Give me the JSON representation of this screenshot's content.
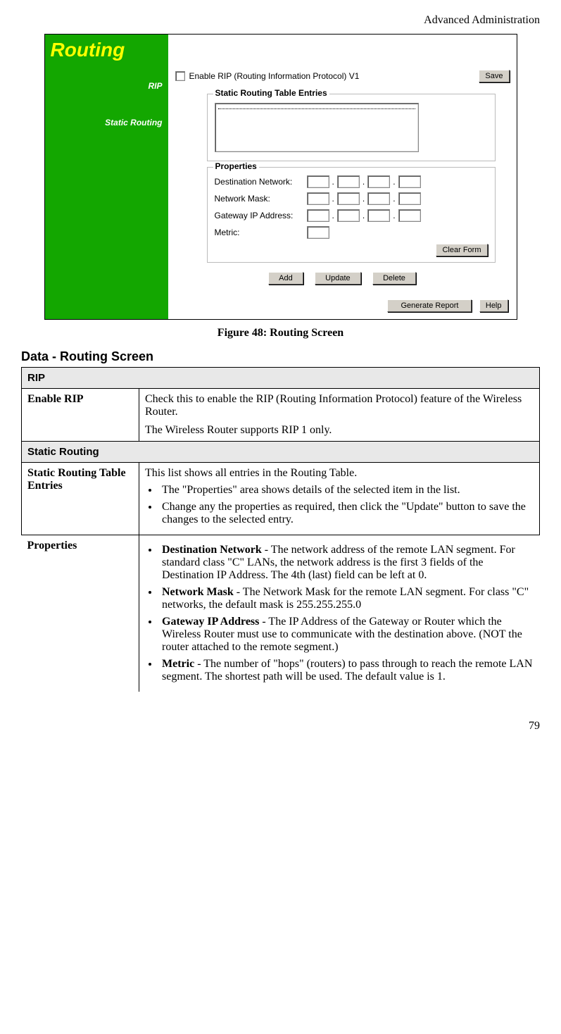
{
  "header": {
    "section": "Advanced Administration"
  },
  "routerUi": {
    "title": "Routing",
    "sidebar": {
      "rip": "RIP",
      "static": "Static Routing"
    },
    "rip": {
      "checkboxLabel": "Enable RIP (Routing Information Protocol) V1",
      "saveBtn": "Save"
    },
    "staticBox": {
      "legend": "Static Routing Table Entries"
    },
    "propsBox": {
      "legend": "Properties",
      "destLabel": "Destination Network:",
      "maskLabel": "Network Mask:",
      "gwLabel": "Gateway IP Address:",
      "metricLabel": "Metric:",
      "clearBtn": "Clear Form"
    },
    "buttons": {
      "add": "Add",
      "update": "Update",
      "delete": "Delete"
    },
    "footer": {
      "report": "Generate Report",
      "help": "Help"
    }
  },
  "figureCaption": "Figure 48: Routing Screen",
  "sectionHeading": "Data - Routing Screen",
  "table": {
    "group1": "RIP",
    "r1Label": "Enable RIP",
    "r1p1": "Check this to enable the RIP (Routing Information Protocol) feature of the Wireless Router.",
    "r1p2": "The Wireless Router supports RIP 1 only.",
    "group2": "Static Routing",
    "r2Label": "Static Routing Table Entries",
    "r2intro": "This list shows all entries in the Routing Table.",
    "r2b1": "The \"Properties\" area shows details of the selected item in the list.",
    "r2b2": "Change any the properties as required, then click the \"Update\" button to save the changes to the selected entry.",
    "r3Label": "Properties",
    "r3b1b": "Destination Network",
    "r3b1t": " - The network address of the remote LAN segment. For standard class \"C\" LANs, the network address is the first 3 fields of the Destination IP Address. The 4th (last) field can be left at 0.",
    "r3b2b": "Network Mask",
    "r3b2t": " - The Network Mask for the remote LAN segment. For class \"C\" networks, the default mask is 255.255.255.0",
    "r3b3b": "Gateway IP Address",
    "r3b3t": " - The IP Address of the Gateway or Router which the Wireless Router must use to communicate with the destination above. (NOT the router attached to the remote segment.)",
    "r3b4b": "Metric",
    "r3b4t": " - The number of \"hops\" (routers) to pass through to reach the remote LAN segment. The shortest path will be used. The default value is 1."
  },
  "pageNumber": "79"
}
